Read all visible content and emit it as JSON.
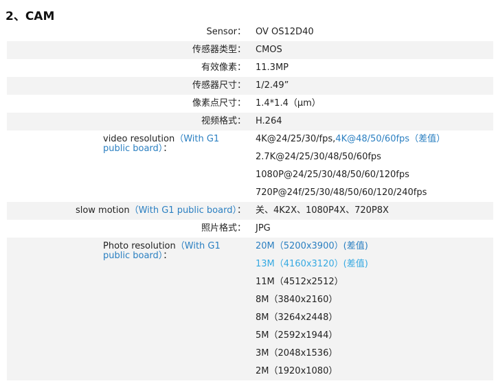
{
  "heading": "2、CAM",
  "rows": [
    {
      "label": "Sensor：",
      "shaded": false,
      "lines": [
        [
          {
            "t": "OV  OS12D40",
            "c": "dark"
          }
        ]
      ]
    },
    {
      "label": "传感器类型：",
      "shaded": true,
      "lines": [
        [
          {
            "t": "CMOS",
            "c": "dark"
          }
        ]
      ]
    },
    {
      "label": "有效像素：",
      "shaded": false,
      "lines": [
        [
          {
            "t": "11.3MP",
            "c": "dark"
          }
        ]
      ]
    },
    {
      "label": "传感器尺寸：",
      "shaded": true,
      "lines": [
        [
          {
            "t": "1/2.49”",
            "c": "dark"
          }
        ]
      ]
    },
    {
      "label": "像素点尺寸：",
      "shaded": false,
      "lines": [
        [
          {
            "t": "1.4*1.4（μm）",
            "c": "dark"
          }
        ]
      ]
    },
    {
      "label": "视频格式：",
      "shaded": true,
      "lines": [
        [
          {
            "t": "H.264",
            "c": "dark"
          }
        ]
      ]
    },
    {
      "label_parts": [
        {
          "t": "video resolution",
          "c": "dark"
        },
        {
          "t": "（With G1 public board）",
          "c": "blue"
        },
        {
          "t": "：",
          "c": "dark"
        }
      ],
      "shaded": false,
      "lines": [
        [
          {
            "t": "4K@24/25/30/fps,",
            "c": "dark"
          },
          {
            "t": "4K@48/50/60fps（差值）",
            "c": "blue"
          }
        ],
        [
          {
            "t": "2.7K@24/25/30/48/50/60fps",
            "c": "dark"
          }
        ],
        [
          {
            "t": "1080P@24/25/30/48/50/60/120fps",
            "c": "dark"
          }
        ],
        [
          {
            "t": "720P@24f/25/30/48/50/60/120/240fps",
            "c": "dark"
          }
        ]
      ]
    },
    {
      "label_parts": [
        {
          "t": "slow motion",
          "c": "dark"
        },
        {
          "t": "（With G1 public board）",
          "c": "blue"
        },
        {
          "t": "：",
          "c": "dark"
        }
      ],
      "shaded": true,
      "inline": true,
      "lines": [
        [
          {
            "t": "关、4K2X、1080P4X、720P8X",
            "c": "dark"
          }
        ]
      ]
    },
    {
      "label": "照片格式：",
      "shaded": false,
      "lines": [
        [
          {
            "t": "JPG",
            "c": "dark"
          }
        ]
      ]
    },
    {
      "label_parts": [
        {
          "t": "Photo resolution",
          "c": "dark"
        },
        {
          "t": "（With G1 public board）",
          "c": "blue"
        },
        {
          "t": "：",
          "c": "dark"
        }
      ],
      "shaded": true,
      "lines": [
        [
          {
            "t": "20M（5200x3900）(差值)",
            "c": "blue"
          }
        ],
        [
          {
            "t": "13M（4160x3120）(差值)",
            "c": "cyan"
          }
        ],
        [
          {
            "t": "11M（4512x2512）",
            "c": "dark"
          }
        ],
        [
          {
            "t": "8M（3840x2160）",
            "c": "dark"
          }
        ],
        [
          {
            "t": "8M（3264x2448）",
            "c": "dark"
          }
        ],
        [
          {
            "t": "5M（2592x1944）",
            "c": "dark"
          }
        ],
        [
          {
            "t": "3M（2048x1536）",
            "c": "dark"
          }
        ],
        [
          {
            "t": "2M（1920x1080）",
            "c": "dark"
          }
        ]
      ]
    }
  ]
}
